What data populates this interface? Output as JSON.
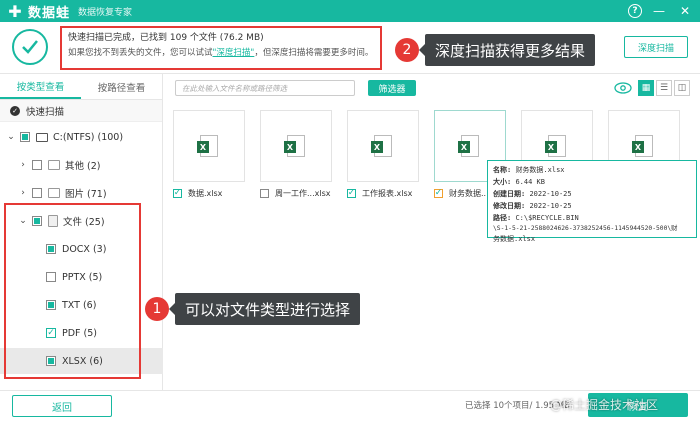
{
  "titlebar": {
    "app_name": "数据蛙",
    "subtitle": "数据恢复专家",
    "help": "?",
    "minimize": "—",
    "close": "✕"
  },
  "status": {
    "line1": "快速扫描已完成，已找到  109 个文件 (76.2 MB)",
    "line2_prefix": "如果您找不到丢失的文件，您可以试试",
    "line2_link": "\"深度扫描\"",
    "line2_suffix": "，但深度扫描将需要更多时间。",
    "deep_button": "深度扫描"
  },
  "sidebar": {
    "tab_type": "按类型查看",
    "tab_path": "按路径查看",
    "quick_scan": "快速扫描",
    "drive": "C:(NTFS) (100)",
    "other": "其他 (2)",
    "images": "图片 (71)",
    "files": "文件 (25)",
    "docx": "DOCX (3)",
    "pptx": "PPTX (5)",
    "txt": "TXT (6)",
    "pdf": "PDF (5)",
    "xlsx": "XLSX (6)"
  },
  "toolbar": {
    "search_placeholder": "在此处输入文件名称或路径筛选",
    "filter": "筛选器"
  },
  "files": [
    {
      "name": "数据.xlsx"
    },
    {
      "name": "周一工作...xlsx"
    },
    {
      "name": "工作报表.xlsx"
    },
    {
      "name": "财务数据..."
    }
  ],
  "tooltip": {
    "name_k": "名称:",
    "name_v": "财务数据.xlsx",
    "size_k": "大小:",
    "size_v": "6.44 KB",
    "created_k": "创建日期:",
    "created_v": "2022-10-25",
    "modified_k": "修改日期:",
    "modified_v": "2022-10-25",
    "path_k": "路径:",
    "path_v1": "C:\\$RECYCLE.BIN",
    "path_v2": "\\S-1-5-21-2588024626-3738252456-1145944520-500\\财",
    "path_v3": "务数据.xlsx"
  },
  "callouts": {
    "c1_num": "1",
    "c1_text": "可以对文件类型进行选择",
    "c2_num": "2",
    "c2_text": "深度扫描获得更多结果"
  },
  "bottom": {
    "back": "返回",
    "selection_info": "已选择 10个项目/ 1.95 MB",
    "recover": "恢复",
    "watermark": "@稀土掘金技术社区"
  },
  "colors": {
    "accent": "#17b8a0",
    "highlight_red": "#e53935"
  }
}
